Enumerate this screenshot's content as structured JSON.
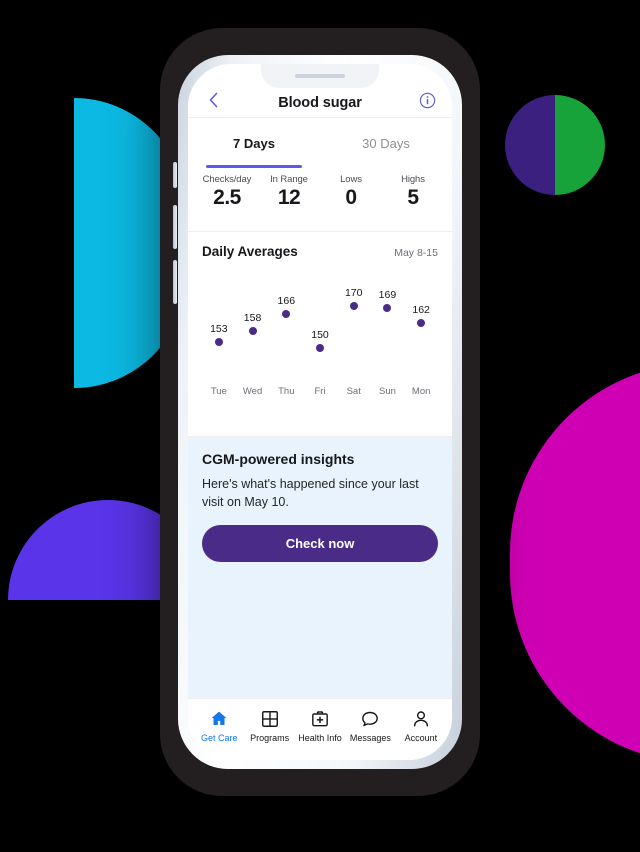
{
  "app": {
    "topbar": {
      "back_icon": "chevron-left-icon",
      "title": "Blood sugar",
      "info_icon": "info-circle-icon"
    },
    "tabs": [
      {
        "label": "7 Days",
        "active": true
      },
      {
        "label": "30 Days",
        "active": false
      }
    ],
    "stats": [
      {
        "label": "Checks/day",
        "value": "2.5"
      },
      {
        "label": "In Range",
        "value": "12"
      },
      {
        "label": "Lows",
        "value": "0"
      },
      {
        "label": "Highs",
        "value": "5"
      }
    ],
    "chart": {
      "title": "Daily Averages",
      "range": "May 8-15"
    },
    "insights": {
      "title": "CGM-powered insights",
      "body": "Here's what's happened since your last visit on May 10.",
      "cta_label": "Check now"
    },
    "bottom_nav": [
      {
        "label": "Get Care",
        "icon": "home-icon",
        "active": true
      },
      {
        "label": "Programs",
        "icon": "grid-icon",
        "active": false
      },
      {
        "label": "Health Info",
        "icon": "medical-bag-icon",
        "active": false
      },
      {
        "label": "Messages",
        "icon": "chat-bubble-icon",
        "active": false
      },
      {
        "label": "Account",
        "icon": "person-icon",
        "active": false
      }
    ]
  },
  "colors": {
    "accent_indigo": "#5a5aee",
    "deep_purple": "#4a2b87",
    "nav_active_blue": "#1577e8",
    "insight_bg": "#e8f3fd",
    "shape_cyan": "#0cb9e2",
    "shape_violet": "#5a34e8",
    "shape_magenta": "#cf00b4",
    "shape_green": "#18a23a",
    "shape_dark_purple": "#3b2080"
  },
  "chart_data": {
    "type": "scatter",
    "title": "Daily Averages",
    "subtitle": "May 8-15",
    "xlabel": "",
    "ylabel": "",
    "categories": [
      "Tue",
      "Wed",
      "Thu",
      "Fri",
      "Sat",
      "Sun",
      "Mon"
    ],
    "values": [
      153,
      158,
      166,
      150,
      170,
      169,
      162
    ],
    "point_labels": [
      "153",
      "158",
      "166",
      "150",
      "170",
      "169",
      "162"
    ],
    "ylim": [
      145,
      175
    ],
    "grid": false,
    "legend": false,
    "marker_color": "#4a2b87"
  }
}
